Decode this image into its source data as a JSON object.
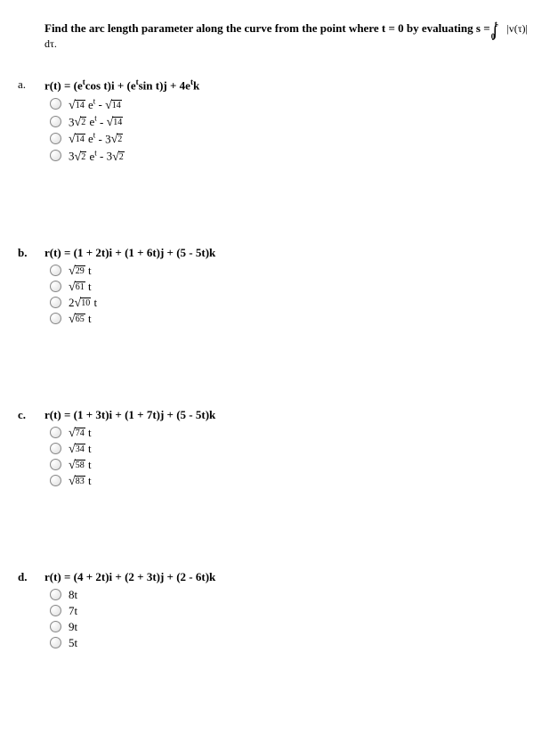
{
  "prompt": {
    "text_before": "Find the arc length parameter along the curve from the point where t = 0 by evaluating s = ",
    "integral_symbol": "∫",
    "upper_limit": "t",
    "lower_limit": "0",
    "integrand": " |v(τ)| dτ."
  },
  "questions": [
    {
      "label": "a.",
      "bold_label": false,
      "stem": {
        "kind": "rt_exp",
        "pre": "r(t) = (e",
        "s1": "t",
        "mid1": "cos t)i + (e",
        "s2": "t",
        "mid2": "sin t)j + 4e",
        "s3": "t",
        "post": "k"
      },
      "options": [
        {
          "kind": "sqrt_et_minus_sqrt",
          "a": "14",
          "b": "14",
          "coef": ""
        },
        {
          "kind": "coef_sqrt_et_minus_sqrt",
          "coef": "3",
          "a": "2",
          "b": "14"
        },
        {
          "kind": "sqrt_et_minus_coef_sqrt",
          "a": "14",
          "coef2": "3",
          "b": "2"
        },
        {
          "kind": "coef_sqrt_et_minus_coef_sqrt",
          "coef": "3",
          "a": "2",
          "coef2": "3",
          "b": "2"
        }
      ]
    },
    {
      "label": "b.",
      "bold_label": true,
      "stem": {
        "kind": "plain",
        "text": "r(t) = (1 + 2t)i + (1 + 6t)j + (5 - 5t)k"
      },
      "options": [
        {
          "kind": "sqrt_t",
          "a": "29",
          "coef": ""
        },
        {
          "kind": "sqrt_t",
          "a": "61",
          "coef": ""
        },
        {
          "kind": "sqrt_t",
          "a": "10",
          "coef": "2"
        },
        {
          "kind": "sqrt_t",
          "a": "65",
          "coef": ""
        }
      ]
    },
    {
      "label": "c.",
      "bold_label": true,
      "stem": {
        "kind": "plain",
        "text": "r(t) = (1 + 3t)i + (1 + 7t)j + (5 - 5t)k"
      },
      "options": [
        {
          "kind": "sqrt_t",
          "a": "74",
          "coef": ""
        },
        {
          "kind": "sqrt_t",
          "a": "34",
          "coef": ""
        },
        {
          "kind": "sqrt_t",
          "a": "58",
          "coef": ""
        },
        {
          "kind": "sqrt_t",
          "a": "83",
          "coef": ""
        }
      ]
    },
    {
      "label": "d.",
      "bold_label": true,
      "stem": {
        "kind": "plain",
        "text": "r(t) = (4 + 2t)i + (2 + 3t)j + (2 - 6t)k"
      },
      "options": [
        {
          "kind": "plain",
          "text": "8t"
        },
        {
          "kind": "plain",
          "text": "7t"
        },
        {
          "kind": "plain",
          "text": "9t"
        },
        {
          "kind": "plain",
          "text": "5t"
        }
      ]
    }
  ]
}
